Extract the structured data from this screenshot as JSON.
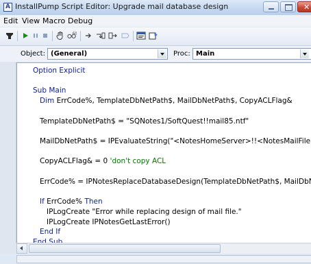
{
  "window": {
    "icon_letter": "A",
    "title": "InstallPump Script Editor: Upgrade mail database design"
  },
  "menu": {
    "items": [
      "Edit",
      "View",
      "Macro",
      "Debug"
    ]
  },
  "toolbar": {
    "icons": [
      "module-icon",
      "run-icon",
      "pause-icon",
      "stop-icon",
      "hand-icon",
      "watch-icon",
      "step-over-icon",
      "step-into-icon",
      "step-out-icon",
      "breakpoint-icon",
      "window-icon",
      "properties-icon"
    ]
  },
  "object_row": {
    "object_label": "Object:",
    "object_value": "(General)",
    "proc_label": "Proc:",
    "proc_value": "Main"
  },
  "code": {
    "lines": [
      [
        {
          "t": "Option Explicit",
          "c": "kw"
        }
      ],
      [],
      [
        {
          "t": "Sub Main",
          "c": "kw"
        }
      ],
      [
        {
          "t": "   "
        },
        {
          "t": "Dim",
          "c": "kw"
        },
        {
          "t": " ErrCode%, TemplateDbNetPath$, MailDbNetPath$, CopyACLFlag&"
        }
      ],
      [],
      [
        {
          "t": "   TemplateDbNetPath$ = \"SQNotes1/SoftQuest!!mail85.ntf\""
        }
      ],
      [],
      [
        {
          "t": "   MailDbNetPath$ = IPEvaluateString(\"<NotesHomeServer>!!<NotesMailFilename>\")"
        }
      ],
      [],
      [
        {
          "t": "   CopyACLFlag& = 0 "
        },
        {
          "t": "'don't copy ACL",
          "c": "cm"
        }
      ],
      [],
      [
        {
          "t": "   ErrCode% = IPNotesReplaceDatabaseDesign(TemplateDbNetPath$, MailDbNetPath$, CopyACLFlag&)"
        }
      ],
      [],
      [
        {
          "t": "   "
        },
        {
          "t": "If",
          "c": "kw"
        },
        {
          "t": " ErrCode% "
        },
        {
          "t": "Then",
          "c": "kw"
        }
      ],
      [
        {
          "t": "      IPLogCreate \"Error while replacing design of mail file.\""
        }
      ],
      [
        {
          "t": "      IPLogCreate IPNotesGetLastError()"
        }
      ],
      [
        {
          "t": "   "
        },
        {
          "t": "End If",
          "c": "kw"
        }
      ],
      [
        {
          "t": "End Sub",
          "c": "kw"
        }
      ]
    ]
  }
}
